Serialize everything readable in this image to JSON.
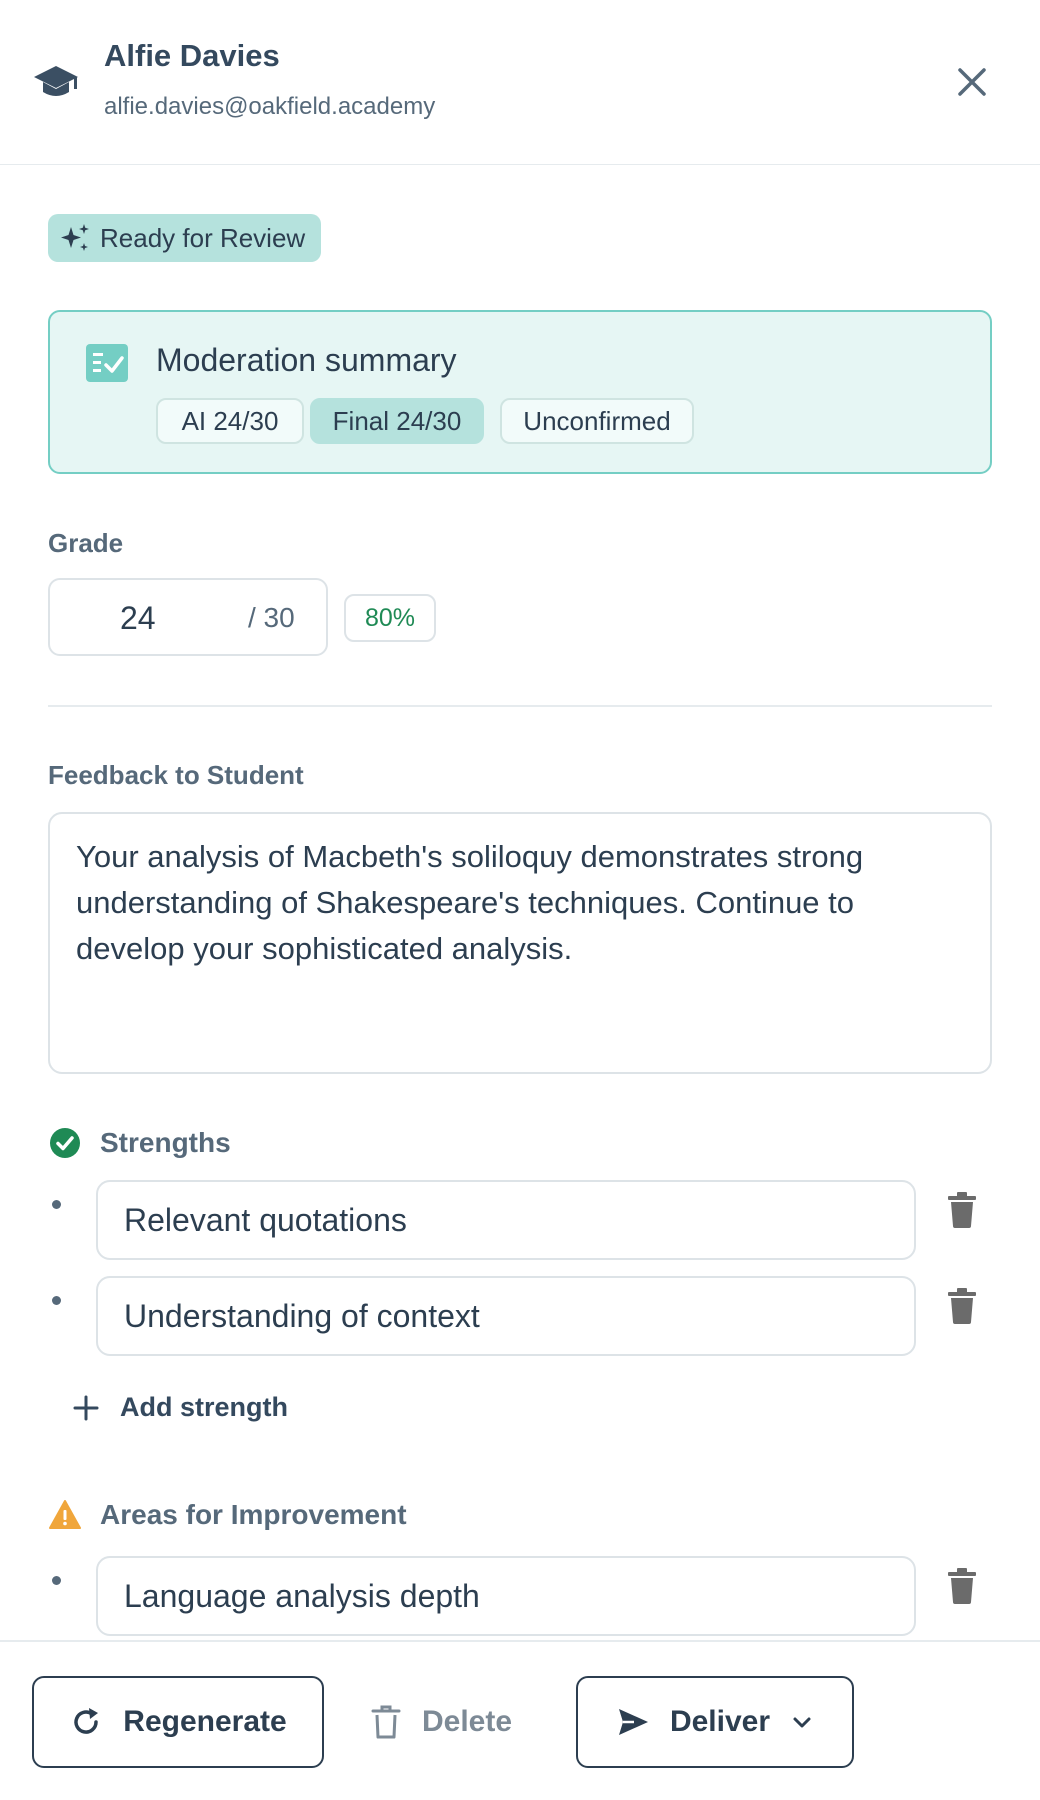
{
  "header": {
    "student_name": "Alfie Davies",
    "student_email": "alfie.davies@oakfield.academy",
    "icon": "graduation-cap-icon",
    "close_icon": "close-icon"
  },
  "status": {
    "label": "Ready for Review",
    "icon": "sparkles-icon",
    "color": "#b5e2dd"
  },
  "moderation": {
    "title": "Moderation summary",
    "icon": "checklist-icon",
    "chips": [
      {
        "label": "AI 24/30",
        "active": false
      },
      {
        "label": "Final 24/30",
        "active": true
      },
      {
        "label": "Unconfirmed",
        "active": false
      }
    ],
    "accent": "#74cec4"
  },
  "grade": {
    "label": "Grade",
    "value": "24",
    "max": "/ 30",
    "percent": "80%",
    "percent_color": "#1f8a55"
  },
  "feedback": {
    "label": "Feedback to Student",
    "text": "Your analysis of Macbeth's soliloquy demonstrates strong understanding of Shakespeare's techniques. Continue to develop your sophisticated analysis."
  },
  "strengths": {
    "label": "Strengths",
    "icon": "check-circle-icon",
    "color": "#1f8a55",
    "items": [
      "Relevant quotations",
      "Understanding of context"
    ],
    "add_label": "Add strength"
  },
  "improvements": {
    "label": "Areas for Improvement",
    "icon": "warning-icon",
    "color": "#f0a63b",
    "items": [
      "Language analysis depth"
    ]
  },
  "footer": {
    "regenerate_label": "Regenerate",
    "delete_label": "Delete",
    "deliver_label": "Deliver"
  }
}
